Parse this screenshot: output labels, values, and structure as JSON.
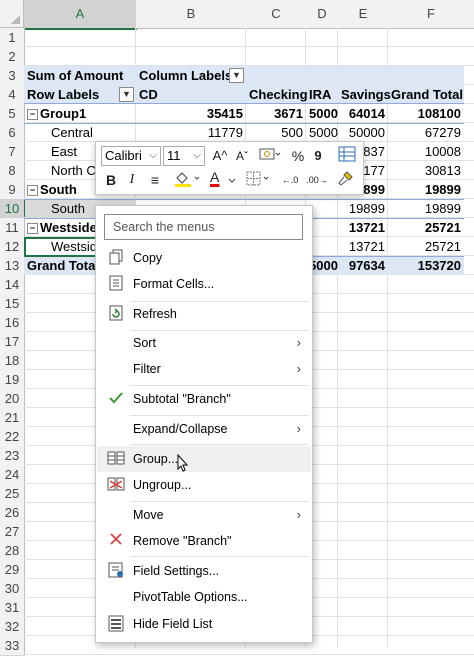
{
  "columns": [
    "A",
    "B",
    "C",
    "D",
    "E",
    "F"
  ],
  "rows": [
    "1",
    "2",
    "3",
    "4",
    "5",
    "6",
    "7",
    "8",
    "9",
    "10",
    "11",
    "12",
    "13",
    "14",
    "15",
    "16",
    "17",
    "18",
    "19",
    "20",
    "21",
    "22",
    "23",
    "24",
    "25",
    "26",
    "27",
    "28",
    "29",
    "30",
    "31",
    "32",
    "33"
  ],
  "pivot": {
    "r3": {
      "a": "Sum of Amount",
      "b": "Column Labels"
    },
    "r4": {
      "a": "Row Labels",
      "b": "CD",
      "c": "Checking",
      "d": "IRA",
      "e": "Savings",
      "f": "Grand Total"
    },
    "r5": {
      "a": "Group1",
      "b": "35415",
      "c": "3671",
      "d": "5000",
      "e": "64014",
      "f": "108100"
    },
    "r6": {
      "a": "Central",
      "b": "11779",
      "c": "500",
      "d": "5000",
      "e": "50000",
      "f": "67279"
    },
    "r7": {
      "a": "East",
      "e": "5837",
      "f": "10008"
    },
    "r8": {
      "a": "North C",
      "e": "7177",
      "f": "30813"
    },
    "r9": {
      "a": "South",
      "e": "9899",
      "f": "19899"
    },
    "r10": {
      "a": "South",
      "e": "19899",
      "f": "19899"
    },
    "r11": {
      "a": "Westside",
      "e": "13721",
      "f": "25721"
    },
    "r12": {
      "a": "Westsid",
      "e": "13721",
      "f": "25721"
    },
    "r13": {
      "a": "Grand Total",
      "d": "5000",
      "e": "97634",
      "f": "153720"
    },
    "collapse_symbol": "−"
  },
  "mini_toolbar": {
    "font_name": "Calibri",
    "font_size": "11",
    "grow_font": "A^",
    "shrink_font": "Aˇ",
    "percent": "%",
    "comma": "9",
    "bold": "B",
    "italic": "I",
    "font_color_letter": "A",
    "increase_decimal": "←.0",
    "decrease_decimal": ".00→"
  },
  "menu": {
    "search_placeholder": "Search the menus",
    "items": [
      {
        "label": "Copy"
      },
      {
        "label": "Format Cells..."
      },
      {
        "label": "Refresh"
      },
      {
        "label": "Sort"
      },
      {
        "label": "Filter"
      },
      {
        "label": "Subtotal \"Branch\""
      },
      {
        "label": "Expand/Collapse"
      },
      {
        "label": "Group..."
      },
      {
        "label": "Ungroup..."
      },
      {
        "label": "Move"
      },
      {
        "label": "Remove \"Branch\""
      },
      {
        "label": "Field Settings..."
      },
      {
        "label": "PivotTable Options..."
      },
      {
        "label": "Hide Field List"
      }
    ]
  },
  "colors": {
    "accent": "#217346",
    "pivot_band": "#dce6f4",
    "check": "#3a9c3a",
    "remove": "#d83b3b"
  }
}
